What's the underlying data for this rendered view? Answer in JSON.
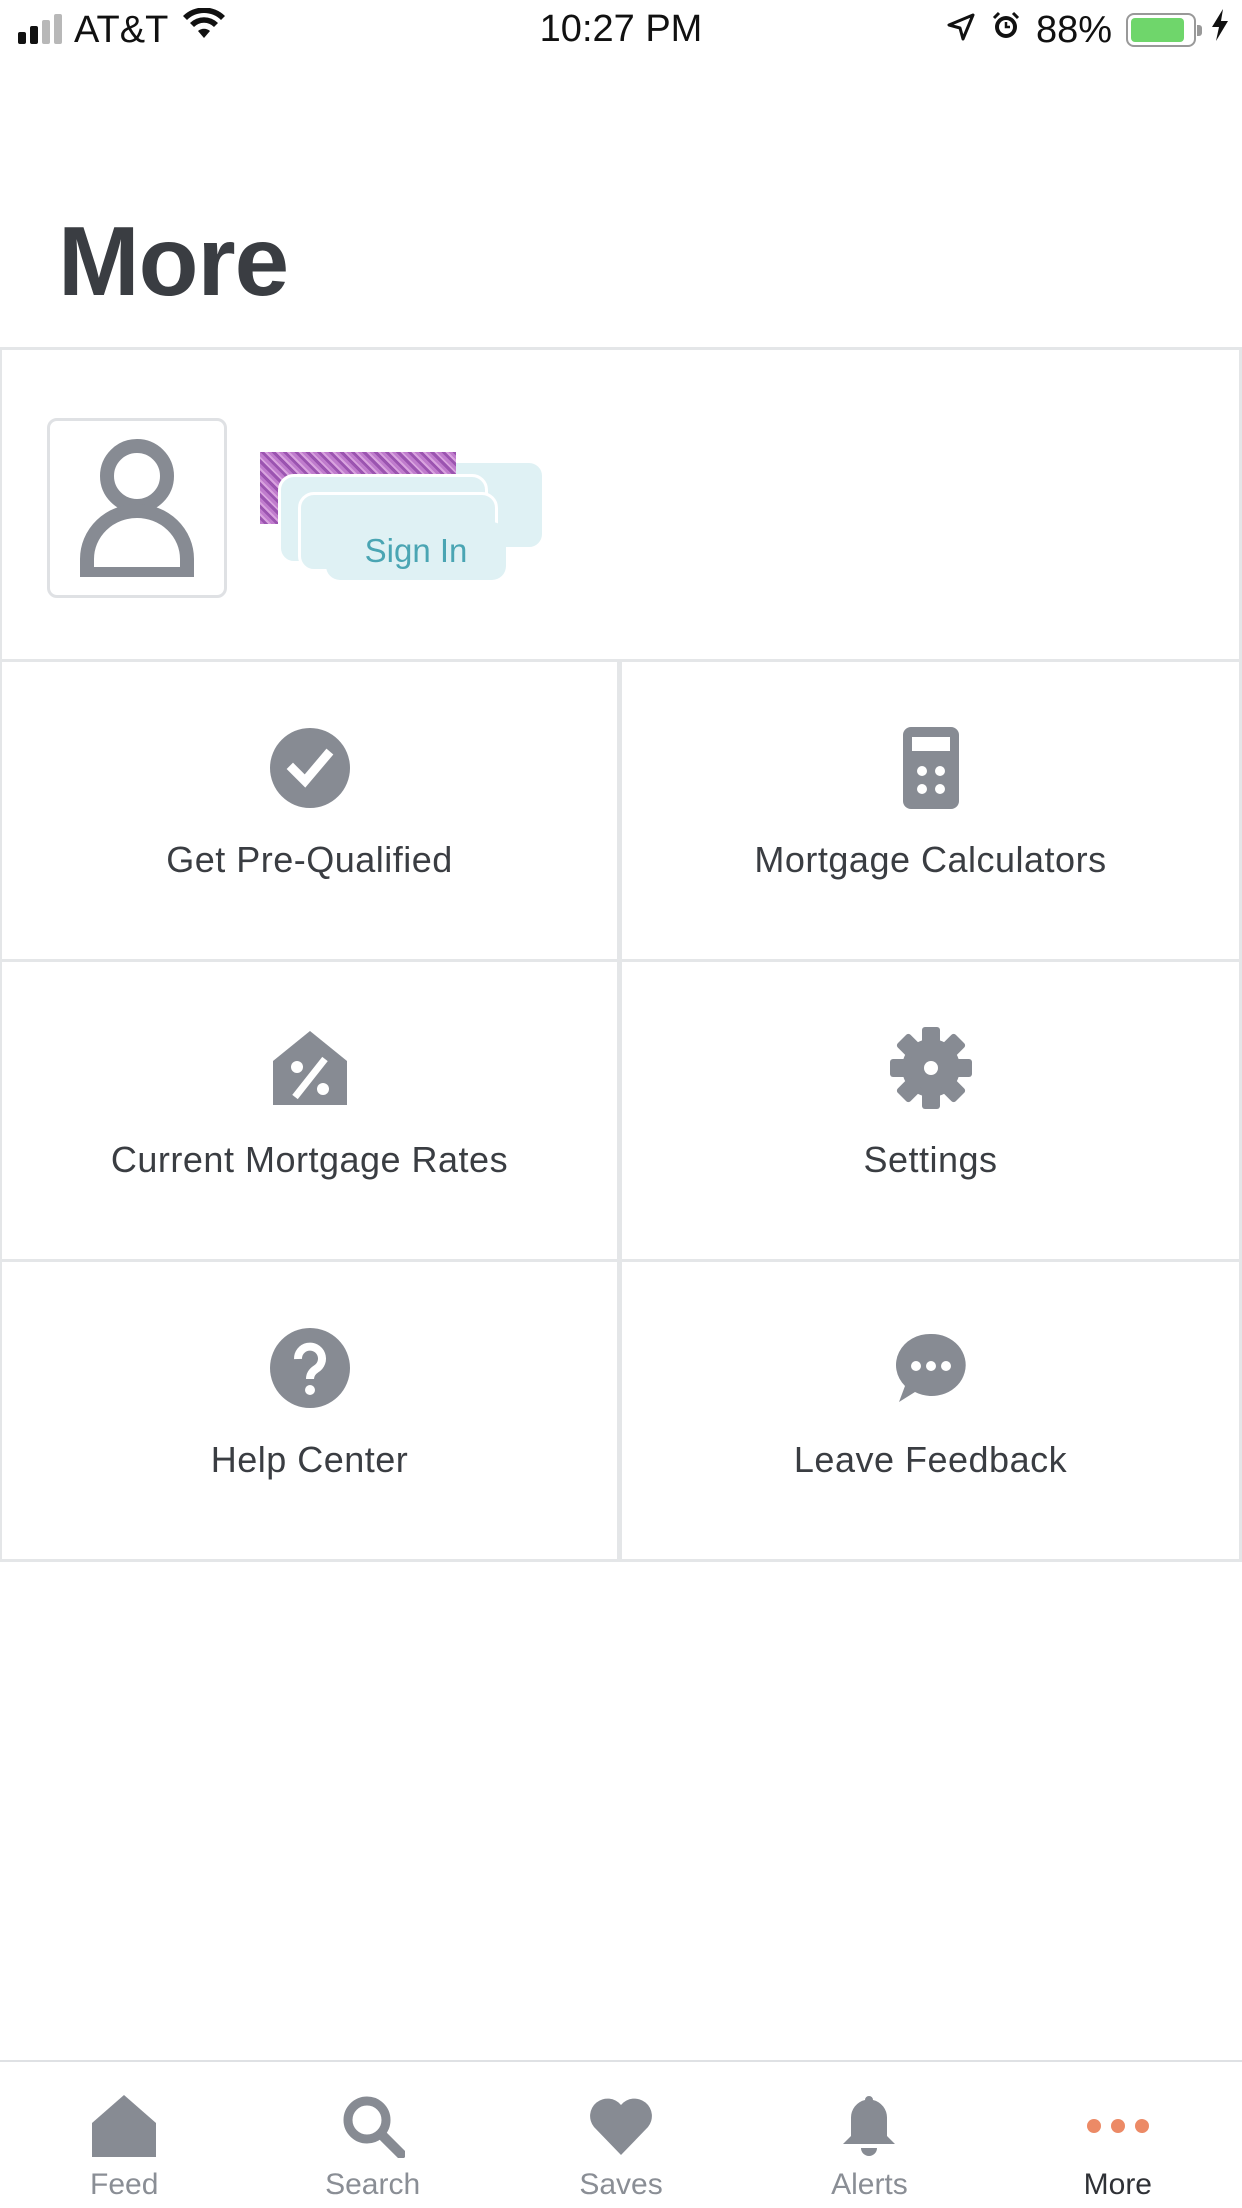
{
  "status_bar": {
    "carrier": "AT&T",
    "time": "10:27 PM",
    "battery_percent": "88%",
    "battery_level": 0.88,
    "icons": [
      "signal-icon",
      "wifi-icon",
      "location-arrow-icon",
      "alarm-icon",
      "battery-icon",
      "charging-bolt-icon"
    ]
  },
  "page": {
    "title": "More"
  },
  "profile": {
    "signin_label": "Sign In",
    "avatar_icon": "user-placeholder-icon"
  },
  "menu": {
    "items": [
      {
        "label": "Get Pre-Qualified",
        "icon": "check-circle-icon"
      },
      {
        "label": "Mortgage Calculators",
        "icon": "calculator-icon"
      },
      {
        "label": "Current Mortgage Rates",
        "icon": "percent-house-icon"
      },
      {
        "label": "Settings",
        "icon": "gear-icon"
      },
      {
        "label": "Help Center",
        "icon": "question-circle-icon"
      },
      {
        "label": "Leave Feedback",
        "icon": "chat-bubble-icon"
      }
    ]
  },
  "tab_bar": {
    "tabs": [
      {
        "label": "Feed",
        "icon": "home-icon",
        "active": false
      },
      {
        "label": "Search",
        "icon": "search-icon",
        "active": false
      },
      {
        "label": "Saves",
        "icon": "heart-icon",
        "active": false
      },
      {
        "label": "Alerts",
        "icon": "bell-icon",
        "active": false
      },
      {
        "label": "More",
        "icon": "more-dots-icon",
        "active": true
      }
    ]
  },
  "colors": {
    "icon_gray": "#878b93",
    "text_dark": "#3a3d42",
    "accent_active": "#ec8a66",
    "signin_bg": "#dff1f4",
    "signin_text": "#4aa5b3",
    "divider": "#e4e6e8"
  }
}
